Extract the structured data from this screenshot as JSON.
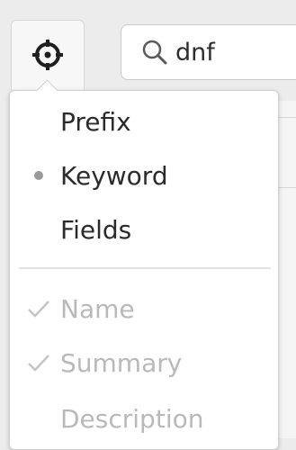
{
  "toolbar": {
    "target_icon": "crosshair-icon",
    "search": {
      "icon": "search-icon",
      "value": "dnf"
    }
  },
  "menu": {
    "search_mode_items": [
      {
        "label": "Prefix",
        "selected": false
      },
      {
        "label": "Keyword",
        "selected": true
      },
      {
        "label": "Fields",
        "selected": false
      }
    ],
    "field_items": [
      {
        "label": "Name",
        "checked": true,
        "enabled": false
      },
      {
        "label": "Summary",
        "checked": true,
        "enabled": false
      },
      {
        "label": "Description",
        "checked": false,
        "enabled": false
      }
    ]
  },
  "colors": {
    "text": "#2b2b2b",
    "disabled_text": "#b9b9b9",
    "radio_dot": "#9a9a9a",
    "checkmark": "#c4c4c4"
  }
}
